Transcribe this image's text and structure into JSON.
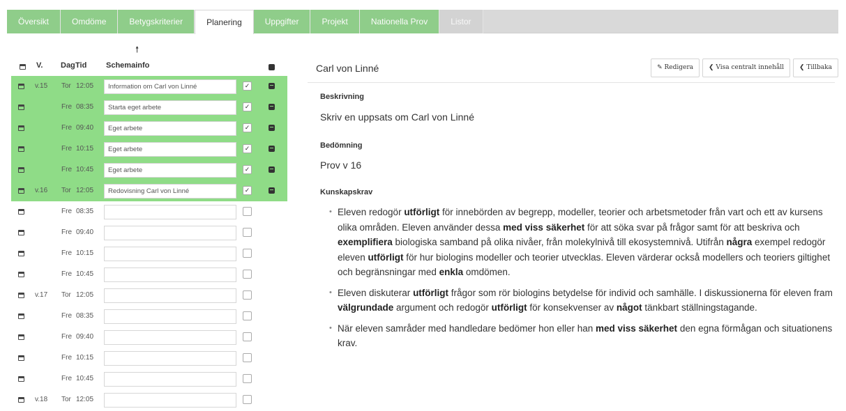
{
  "tabs": [
    {
      "label": "Översikt",
      "style": "green"
    },
    {
      "label": "Omdöme",
      "style": "green"
    },
    {
      "label": "Betygskriterier",
      "style": "green"
    },
    {
      "label": "Planering",
      "style": "active"
    },
    {
      "label": "Uppgifter",
      "style": "green"
    },
    {
      "label": "Projekt",
      "style": "green"
    },
    {
      "label": "Nationella Prov",
      "style": "green"
    },
    {
      "label": "Listor",
      "style": "plain"
    }
  ],
  "schedule": {
    "headers": {
      "week": "V.",
      "day": "Dag",
      "time": "Tid",
      "info": "Schemainfo"
    },
    "rows": [
      {
        "week": "v.15",
        "day": "Tor",
        "time": "12:05",
        "info": "Information om Carl von Linné",
        "checked": "✓",
        "highlight": true
      },
      {
        "week": "",
        "day": "Fre",
        "time": "08:35",
        "info": "Starta eget arbete",
        "checked": "✓",
        "highlight": true
      },
      {
        "week": "",
        "day": "Fre",
        "time": "09:40",
        "info": "Eget arbete",
        "checked": "✓",
        "highlight": true
      },
      {
        "week": "",
        "day": "Fre",
        "time": "10:15",
        "info": "Eget arbete",
        "checked": "✓",
        "highlight": true
      },
      {
        "week": "",
        "day": "Fre",
        "time": "10:45",
        "info": "Eget arbete",
        "checked": "✓",
        "highlight": true
      },
      {
        "week": "v.16",
        "day": "Tor",
        "time": "12:05",
        "info": "Redovisning Carl von Linné",
        "checked": "✓",
        "highlight": true
      },
      {
        "week": "",
        "day": "Fre",
        "time": "08:35",
        "info": "",
        "checked": "",
        "highlight": false
      },
      {
        "week": "",
        "day": "Fre",
        "time": "09:40",
        "info": "",
        "checked": "",
        "highlight": false
      },
      {
        "week": "",
        "day": "Fre",
        "time": "10:15",
        "info": "",
        "checked": "",
        "highlight": false
      },
      {
        "week": "",
        "day": "Fre",
        "time": "10:45",
        "info": "",
        "checked": "",
        "highlight": false
      },
      {
        "week": "v.17",
        "day": "Tor",
        "time": "12:05",
        "info": "",
        "checked": "",
        "highlight": false
      },
      {
        "week": "",
        "day": "Fre",
        "time": "08:35",
        "info": "",
        "checked": "",
        "highlight": false
      },
      {
        "week": "",
        "day": "Fre",
        "time": "09:40",
        "info": "",
        "checked": "",
        "highlight": false
      },
      {
        "week": "",
        "day": "Fre",
        "time": "10:15",
        "info": "",
        "checked": "",
        "highlight": false
      },
      {
        "week": "",
        "day": "Fre",
        "time": "10:45",
        "info": "",
        "checked": "",
        "highlight": false
      },
      {
        "week": "v.18",
        "day": "Tor",
        "time": "12:05",
        "info": "",
        "checked": "",
        "highlight": false
      }
    ]
  },
  "detail": {
    "title": "Carl von Linné",
    "buttons": {
      "edit": "✎ Redigera",
      "central": "❮ Visa centralt innehåll",
      "back": "❮ Tillbaka"
    },
    "description_label": "Beskrivning",
    "description": "Skriv en uppsats om Carl von Linné",
    "assessment_label": "Bedömning",
    "assessment": "Prov v 16",
    "requirements_label": "Kunskapskrav",
    "requirements": [
      [
        {
          "t": "Eleven redogör ",
          "b": false
        },
        {
          "t": "utförligt",
          "b": true
        },
        {
          "t": " för innebörden av begrepp, modeller, teorier och arbetsmetoder från vart och ett av kursens olika områden. Eleven använder dessa ",
          "b": false
        },
        {
          "t": "med viss säkerhet",
          "b": true
        },
        {
          "t": " för att söka svar på frågor samt för att beskriva och ",
          "b": false
        },
        {
          "t": "exemplifiera",
          "b": true
        },
        {
          "t": " biologiska samband på olika nivåer, från molekylnivå till ekosystemnivå. Utifrån ",
          "b": false
        },
        {
          "t": "några",
          "b": true
        },
        {
          "t": " exempel redogör eleven ",
          "b": false
        },
        {
          "t": "utförligt",
          "b": true
        },
        {
          "t": " för hur biologins modeller och teorier utvecklas. Eleven värderar också modellers och teoriers giltighet och begränsningar med ",
          "b": false
        },
        {
          "t": "enkla",
          "b": true
        },
        {
          "t": " omdömen.",
          "b": false
        }
      ],
      [
        {
          "t": "Eleven diskuterar ",
          "b": false
        },
        {
          "t": "utförligt",
          "b": true
        },
        {
          "t": " frågor som rör biologins betydelse för individ och samhälle. I diskussionerna för eleven fram ",
          "b": false
        },
        {
          "t": "välgrundade",
          "b": true
        },
        {
          "t": " argument och redogör ",
          "b": false
        },
        {
          "t": "utförligt",
          "b": true
        },
        {
          "t": " för konsekvenser av ",
          "b": false
        },
        {
          "t": "något",
          "b": true
        },
        {
          "t": " tänkbart ställningstagande.",
          "b": false
        }
      ],
      [
        {
          "t": "När eleven samråder med handledare bedömer hon eller han ",
          "b": false
        },
        {
          "t": "med viss säkerhet",
          "b": true
        },
        {
          "t": " den egna förmågan och situationens krav.",
          "b": false
        }
      ]
    ]
  }
}
